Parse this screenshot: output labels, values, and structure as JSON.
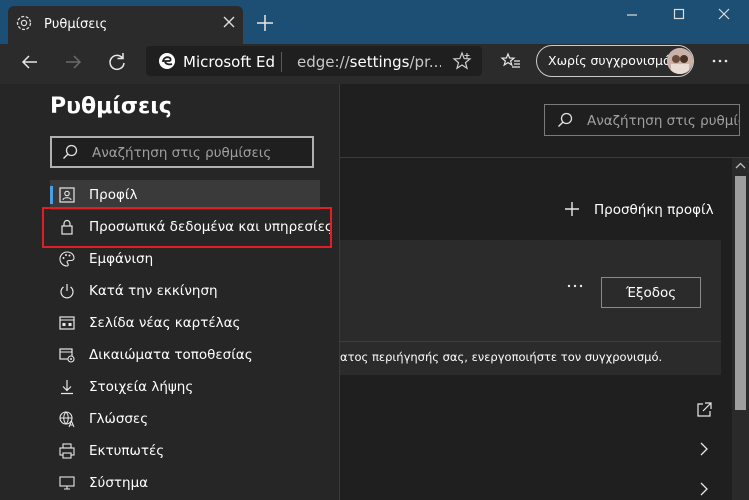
{
  "tab": {
    "title": "Ρυθμίσεις"
  },
  "toolbar": {
    "site_name": "Microsoft Ed",
    "url_prefix": "edge://",
    "url_bold": "settings",
    "url_rest": "/pr...",
    "sync_label": "Χωρίς συγχρονισμό"
  },
  "sidebar": {
    "title": "Ρυθμίσεις",
    "search_placeholder": "Αναζήτηση στις ρυθμίσεις",
    "items": [
      {
        "label": "Προφίλ",
        "icon": "profile-icon"
      },
      {
        "label": "Προσωπικά δεδομένα και υπηρεσίες",
        "icon": "lock-icon"
      },
      {
        "label": "Εμφάνιση",
        "icon": "palette-icon"
      },
      {
        "label": "Κατά την εκκίνηση",
        "icon": "power-icon"
      },
      {
        "label": "Σελίδα νέας καρτέλας",
        "icon": "new-tab-page-icon"
      },
      {
        "label": "Δικαιώματα τοποθεσίας",
        "icon": "site-permissions-icon"
      },
      {
        "label": "Στοιχεία λήψης",
        "icon": "download-icon"
      },
      {
        "label": "Γλώσσες",
        "icon": "languages-icon"
      },
      {
        "label": "Εκτυπωτές",
        "icon": "printer-icon"
      },
      {
        "label": "Σύστημα",
        "icon": "system-icon"
      }
    ]
  },
  "main": {
    "search_placeholder": "Αναζήτηση στις ρυθμίσει",
    "add_profile": "Προσθήκη προφίλ",
    "signout_label": "Έξοδος",
    "sync_hint": "ατος περιήγησής σας, ενεργοποιήστε τον συγχρονισμό."
  },
  "colors": {
    "titlebar": "#1d4e73",
    "highlight": "#e01e25",
    "accent": "#4aa0e6"
  }
}
